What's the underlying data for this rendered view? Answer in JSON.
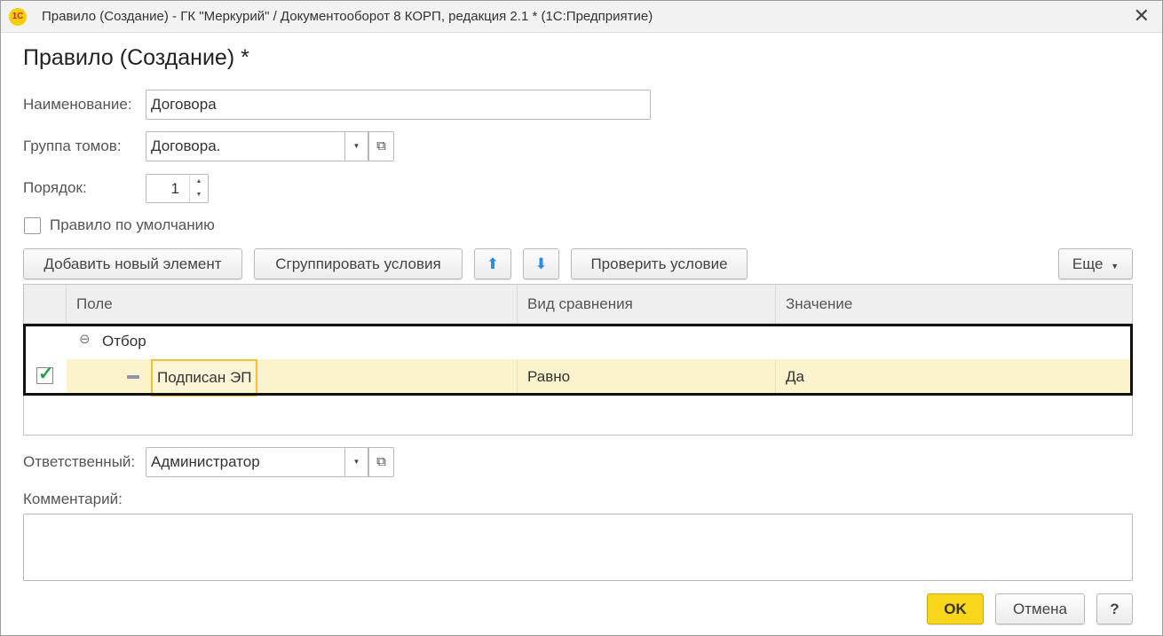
{
  "window": {
    "logo": "1С",
    "title": "Правило (Создание) - ГК \"Меркурий\" / Документооборот 8 КОРП, редакция 2.1 *  (1С:Предприятие)",
    "close": "✕"
  },
  "form": {
    "title": "Правило (Создание) *",
    "name_label": "Наименование:",
    "name_value": "Договора",
    "group_label": "Группа томов:",
    "group_value": "Договора.",
    "order_label": "Порядок:",
    "order_value": "1",
    "default_rule_label": "Правило по умолчанию",
    "default_rule_checked": false
  },
  "toolbar": {
    "add_new": "Добавить новый элемент",
    "group_conditions": "Сгруппировать условия",
    "check_condition": "Проверить условие",
    "more": "Еще"
  },
  "grid": {
    "columns": [
      "Поле",
      "Вид сравнения",
      "Значение"
    ],
    "group_row": {
      "collapse_icon": "⊖",
      "label": "Отбор"
    },
    "rows": [
      {
        "checked": true,
        "field": "Подписан ЭП",
        "comparison": "Равно",
        "value": "Да"
      }
    ]
  },
  "responsible": {
    "label": "Ответственный:",
    "value": "Администратор"
  },
  "comment": {
    "label": "Комментарий:",
    "value": ""
  },
  "footer": {
    "ok": "OK",
    "cancel": "Отмена",
    "help": "?"
  },
  "colors": {
    "accent_ok": "#f7d61b",
    "selected_row": "#fbf3cc",
    "arrow_blue": "#2f8be0",
    "check_green": "#22a34a"
  }
}
